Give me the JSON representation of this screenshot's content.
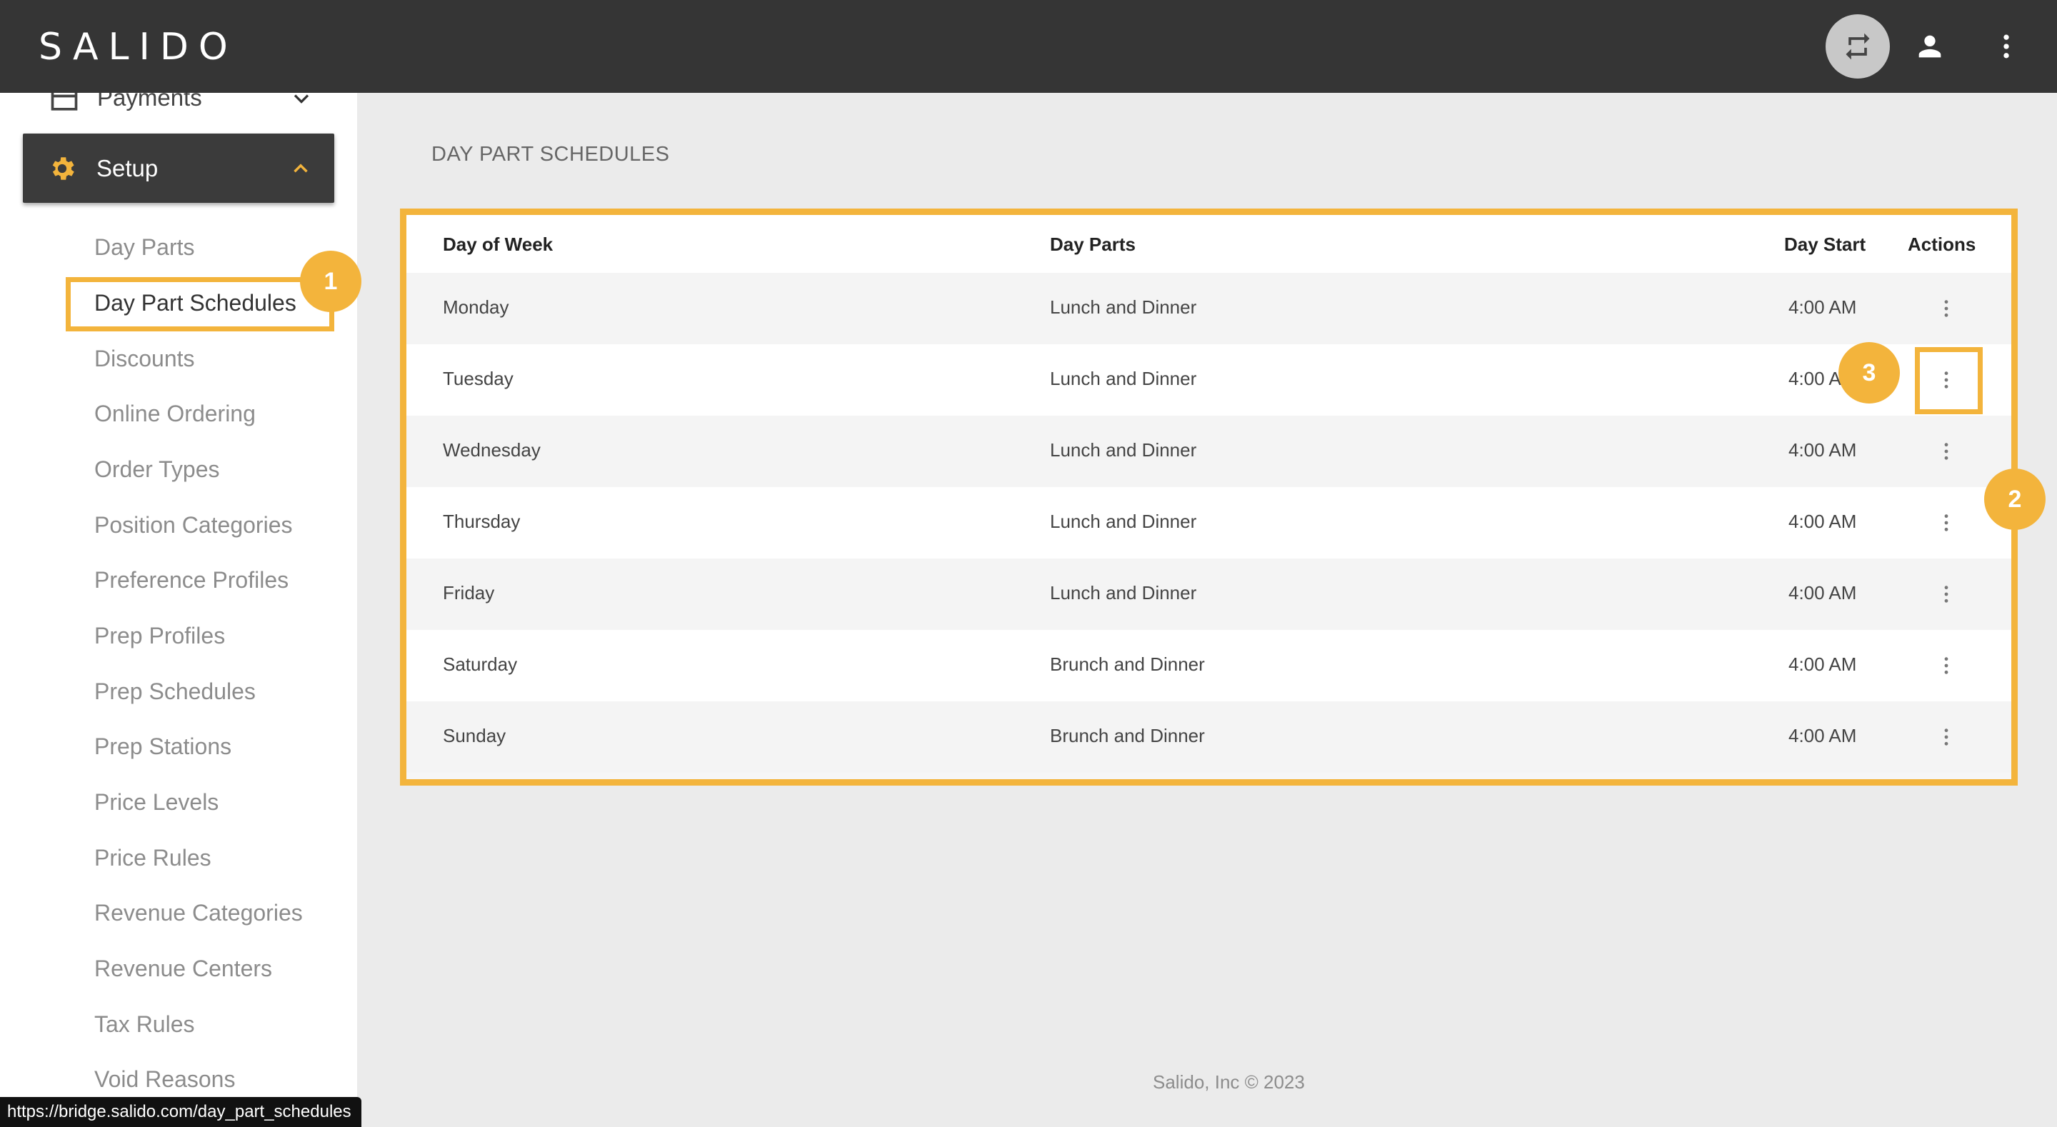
{
  "app": {
    "logo": "SALIDO"
  },
  "header": {
    "switch_icon": "swap-icon",
    "user_icon": "person-icon",
    "more_icon": "more-vert-icon"
  },
  "sidebar": {
    "payments_label": "Payments",
    "setup_label": "Setup",
    "items": [
      {
        "label": "Day Parts"
      },
      {
        "label": "Day Part Schedules"
      },
      {
        "label": "Discounts"
      },
      {
        "label": "Online Ordering"
      },
      {
        "label": "Order Types"
      },
      {
        "label": "Position Categories"
      },
      {
        "label": "Preference Profiles"
      },
      {
        "label": "Prep Profiles"
      },
      {
        "label": "Prep Schedules"
      },
      {
        "label": "Prep Stations"
      },
      {
        "label": "Price Levels"
      },
      {
        "label": "Price Rules"
      },
      {
        "label": "Revenue Categories"
      },
      {
        "label": "Revenue Centers"
      },
      {
        "label": "Tax Rules"
      },
      {
        "label": "Void Reasons"
      }
    ]
  },
  "main": {
    "title": "DAY PART SCHEDULES",
    "columns": [
      "Day of Week",
      "Day Parts",
      "Day Start",
      "Actions"
    ],
    "rows": [
      {
        "day": "Monday",
        "day_parts": "Lunch and Dinner",
        "day_start": "4:00 AM"
      },
      {
        "day": "Tuesday",
        "day_parts": "Lunch and Dinner",
        "day_start": "4:00 AM"
      },
      {
        "day": "Wednesday",
        "day_parts": "Lunch and Dinner",
        "day_start": "4:00 AM"
      },
      {
        "day": "Thursday",
        "day_parts": "Lunch and Dinner",
        "day_start": "4:00 AM"
      },
      {
        "day": "Friday",
        "day_parts": "Lunch and Dinner",
        "day_start": "4:00 AM"
      },
      {
        "day": "Saturday",
        "day_parts": "Brunch and Dinner",
        "day_start": "4:00 AM"
      },
      {
        "day": "Sunday",
        "day_parts": "Brunch and Dinner",
        "day_start": "4:00 AM"
      }
    ]
  },
  "annotations": {
    "badge1": "1",
    "badge2": "2",
    "badge3": "3",
    "accent_color": "#f3b43c"
  },
  "footer": {
    "text": "Salido, Inc © 2023"
  },
  "status_url": "https://bridge.salido.com/day_part_schedules"
}
